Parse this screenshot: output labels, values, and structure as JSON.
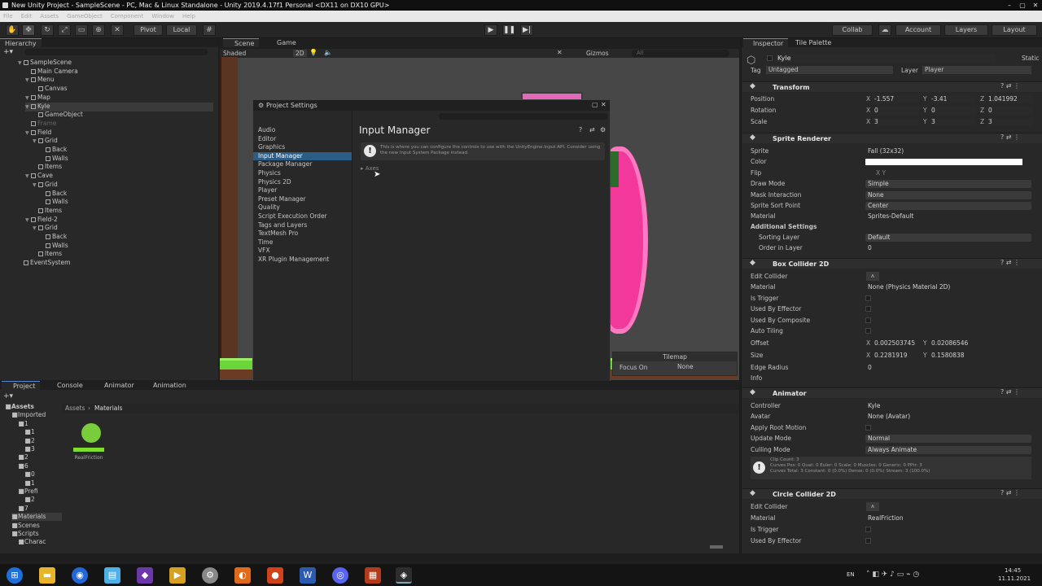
{
  "window": {
    "title": "New Unity Project - SampleScene - PC, Mac & Linux Standalone - Unity 2019.4.17f1 Personal <DX11 on DX10 GPU>",
    "controls": [
      "–",
      "▢",
      "✕"
    ]
  },
  "menu": [
    "File",
    "Edit",
    "Assets",
    "GameObject",
    "Component",
    "Window",
    "Help"
  ],
  "toolbar": {
    "pivot": "Pivot",
    "local": "Local",
    "collab": "Collab",
    "account": "Account",
    "layers": "Layers",
    "layout": "Layout"
  },
  "hierarchy": {
    "tab": "Hierarchy",
    "items": [
      {
        "label": "SampleScene",
        "depth": 0,
        "arrow": "▼"
      },
      {
        "label": "Main Camera",
        "depth": 1,
        "arrow": ""
      },
      {
        "label": "Menu",
        "depth": 1,
        "arrow": "▼"
      },
      {
        "label": "Canvas",
        "depth": 2,
        "arrow": ""
      },
      {
        "label": "Map",
        "depth": 1,
        "arrow": "▼"
      },
      {
        "label": "Kyle",
        "depth": 1,
        "arrow": "▼"
      },
      {
        "label": "GameObject",
        "depth": 2,
        "arrow": ""
      },
      {
        "label": "Frame",
        "depth": 1,
        "arrow": ""
      },
      {
        "label": "Field",
        "depth": 1,
        "arrow": "▼"
      },
      {
        "label": "Grid",
        "depth": 2,
        "arrow": "▼"
      },
      {
        "label": "Back",
        "depth": 3,
        "arrow": ""
      },
      {
        "label": "Walls",
        "depth": 3,
        "arrow": ""
      },
      {
        "label": "Items",
        "depth": 2,
        "arrow": ""
      },
      {
        "label": "Cave",
        "depth": 1,
        "arrow": "▼"
      },
      {
        "label": "Grid",
        "depth": 2,
        "arrow": "▼"
      },
      {
        "label": "Back",
        "depth": 3,
        "arrow": ""
      },
      {
        "label": "Walls",
        "depth": 3,
        "arrow": ""
      },
      {
        "label": "Items",
        "depth": 2,
        "arrow": ""
      },
      {
        "label": "Field-2",
        "depth": 1,
        "arrow": "▼"
      },
      {
        "label": "Grid",
        "depth": 2,
        "arrow": "▼"
      },
      {
        "label": "Back",
        "depth": 3,
        "arrow": ""
      },
      {
        "label": "Walls",
        "depth": 3,
        "arrow": ""
      },
      {
        "label": "Items",
        "depth": 2,
        "arrow": ""
      },
      {
        "label": "EventSystem",
        "depth": 0,
        "arrow": ""
      }
    ]
  },
  "scene": {
    "tabs": [
      "Scene",
      "Game"
    ],
    "shading": "Shaded",
    "mode2d": "2D",
    "gizmos": "Gizmos",
    "search": "All",
    "tilemap": {
      "title": "Tilemap",
      "focus_label": "Focus On",
      "focus_value": "None"
    }
  },
  "project_settings": {
    "title": "Project Settings",
    "heading": "Input Manager",
    "info": "This is where you can configure the controls to use with the UnityEngine.Input API. Consider using the new Input System Package instead.",
    "axes": "Axes",
    "items": [
      "Audio",
      "Editor",
      "Graphics",
      "Input Manager",
      "Package Manager",
      "Physics",
      "Physics 2D",
      "Player",
      "Preset Manager",
      "Quality",
      "Script Execution Order",
      "Tags and Layers",
      "TextMesh Pro",
      "Time",
      "VFX",
      "XR Plugin Management"
    ],
    "selected": "Input Manager"
  },
  "inspector": {
    "tabs": [
      "Inspector",
      "Tile Palette"
    ],
    "object_name": "Kyle",
    "static": "Static",
    "tag_label": "Tag",
    "tag": "Untagged",
    "layer_label": "Layer",
    "layer": "Player",
    "transform": {
      "title": "Transform",
      "position": [
        "-1.557",
        "-3.41",
        "1.041992"
      ],
      "rotation": [
        "0",
        "0",
        "0"
      ],
      "scale": [
        "3",
        "3",
        "3"
      ],
      "labels": [
        "Position",
        "Rotation",
        "Scale"
      ]
    },
    "sprite_renderer": {
      "title": "Sprite Renderer",
      "rows": [
        [
          "Sprite",
          "Fall (32x32)"
        ],
        [
          "Color",
          ""
        ],
        [
          "Flip",
          "X   Y"
        ],
        [
          "Draw Mode",
          "Simple"
        ],
        [
          "Mask Interaction",
          "None"
        ],
        [
          "Sprite Sort Point",
          "Center"
        ],
        [
          "Material",
          "Sprites-Default"
        ]
      ],
      "additional": "Additional Settings",
      "sorting_layer": [
        "Sorting Layer",
        "Default"
      ],
      "order": [
        "Order in Layer",
        "0"
      ]
    },
    "box_collider": {
      "title": "Box Collider 2D",
      "rows": [
        [
          "Edit Collider",
          ""
        ],
        [
          "Material",
          "None (Physics Material 2D)"
        ],
        [
          "Is Trigger",
          ""
        ],
        [
          "Used By Effector",
          ""
        ],
        [
          "Used By Composite",
          ""
        ],
        [
          "Auto Tiling",
          ""
        ]
      ],
      "offset": [
        "Offset",
        "0.002503745",
        "0.02086546"
      ],
      "size": [
        "Size",
        "0.2281919",
        "0.1580838"
      ],
      "edge": [
        "Edge Radius",
        "0"
      ],
      "info": "Info"
    },
    "animator": {
      "title": "Animator",
      "rows": [
        [
          "Controller",
          "Kyle"
        ],
        [
          "Avatar",
          "None (Avatar)"
        ],
        [
          "Apply Root Motion",
          ""
        ],
        [
          "Update Mode",
          "Normal"
        ],
        [
          "Culling Mode",
          "Always Animate"
        ]
      ],
      "clip_info": "Clip Count: 3\nCurves Pos: 0 Quat: 0 Euler: 0 Scale: 0 Muscles: 0 Generic: 0 PPtr: 3\nCurves Total: 3 Constant: 0 (0.0%) Dense: 0 (0.0%) Stream: 3 (100.0%)"
    },
    "circle_collider": {
      "title": "Circle Collider 2D",
      "rows": [
        [
          "Edit Collider",
          ""
        ],
        [
          "Material",
          "RealFriction"
        ],
        [
          "Is Trigger",
          ""
        ],
        [
          "Used By Effector",
          ""
        ]
      ]
    }
  },
  "project": {
    "tabs": [
      "Project",
      "Console",
      "Animator",
      "Animation"
    ],
    "breadcrumb": [
      "Assets",
      "Materials"
    ],
    "tree": [
      "Assets",
      "Imported",
      "1",
      "1",
      "2",
      "3",
      "2",
      "6",
      "0",
      "1",
      "Prefi",
      "2",
      "7",
      "Materials",
      "Scenes",
      "Scripts",
      "Charac"
    ],
    "asset": "RealFriction"
  },
  "taskbar": {
    "lang": "EN",
    "time": "14:45",
    "date": "11.11.2021"
  }
}
